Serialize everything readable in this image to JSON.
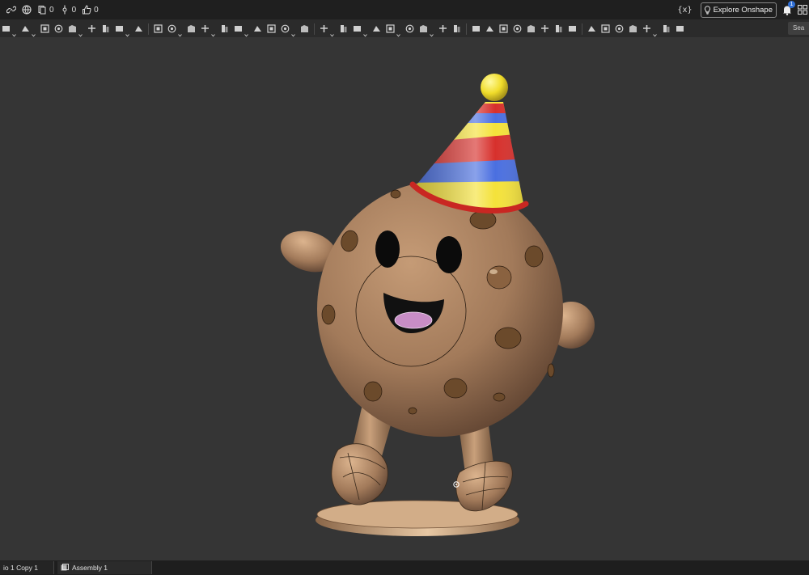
{
  "topbar": {
    "counts": {
      "versions": "0",
      "branches": "0",
      "likes": "0"
    },
    "variables_label": "{x}",
    "explore_label": "Explore Onshape",
    "notification_count": "1"
  },
  "toolbar": {
    "icons": [
      "sketch-icon",
      "extrude-icon",
      "revolve-icon",
      "sweep-icon",
      "loft-icon",
      "thicken-icon",
      "fillet-icon",
      "chamfer-icon",
      "draft-icon",
      "shell-icon",
      "rib-icon",
      "hole-icon",
      "boolean-icon",
      "split-icon",
      "transform-icon",
      "pattern-icon",
      "mirror-icon",
      "delete-part-icon",
      "modify-fillet-icon",
      "move-face-icon",
      "replace-face-icon",
      "offset-surface-icon",
      "plane-icon",
      "helix-icon",
      "curve-icon",
      "variable-icon",
      "mate-connector-icon",
      "appearance-icon",
      "sheet-metal-icon",
      "flange-icon",
      "tab-icon",
      "bend-icon",
      "form-icon",
      "corner-icon",
      "frame-icon",
      "trim-icon",
      "gusset-icon",
      "surface-icon",
      "fill-icon",
      "enclose-icon",
      "extend-icon",
      "section-icon",
      "measure-icon"
    ],
    "search_label": "Sea"
  },
  "bottom_tabs": [
    {
      "label": "io 1 Copy 1"
    },
    {
      "label": "Assembly 1"
    }
  ],
  "colors": {
    "background": "#353535",
    "cookie": "#a27a5a",
    "chip": "#6b4a2b",
    "hat_yellow": "#f4e23a",
    "hat_blue": "#4a6fe0",
    "hat_red": "#d7302c",
    "tongue": "#c88dc6"
  }
}
